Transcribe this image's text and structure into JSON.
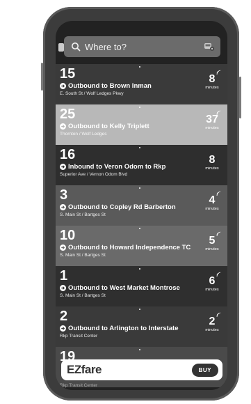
{
  "search": {
    "placeholder": "Where to?"
  },
  "routes": [
    {
      "number": "15",
      "destination": "Outbound to Brown Inman",
      "stop": "E. South St / Wolf Ledges Pkwy",
      "eta": "8",
      "eta_unit": "minutes",
      "realtime": true,
      "bg": "#3a3a3a"
    },
    {
      "number": "25",
      "destination": "Outbound to Kelly Triplett",
      "stop": "Thornton / Wolf Ledges",
      "eta": "37",
      "eta_unit": "minutes",
      "realtime": true,
      "bg": "#b8b8b8"
    },
    {
      "number": "16",
      "destination": "Inbound to Veron Odom to Rkp",
      "stop": "Superior Ave / Vernon Odom Blvd",
      "eta": "8",
      "eta_unit": "minutes",
      "realtime": false,
      "bg": "#2e2e2e"
    },
    {
      "number": "3",
      "destination": "Outbound to Copley Rd Barberton",
      "stop": "S. Main St / Bartges St",
      "eta": "4",
      "eta_unit": "minutes",
      "realtime": true,
      "bg": "#5a5a5a"
    },
    {
      "number": "10",
      "destination": "Outbound to Howard Independence TC",
      "stop": "S. Main St / Bartges St",
      "eta": "5",
      "eta_unit": "minutes",
      "realtime": true,
      "bg": "#6a6a6a"
    },
    {
      "number": "1",
      "destination": "Outbound to West Market Montrose",
      "stop": "S. Main St / Bartges St",
      "eta": "6",
      "eta_unit": "minutes",
      "realtime": true,
      "bg": "#2f2f2f"
    },
    {
      "number": "2",
      "destination": "Outbound to Arlington to Interstate",
      "stop": "Rkp Transit Center",
      "eta": "2",
      "eta_unit": "minutes",
      "realtime": true,
      "bg": "#3a3a3a"
    },
    {
      "number": "19",
      "destination": "",
      "stop": "",
      "eta": "",
      "eta_unit": "",
      "realtime": false,
      "bg": "#4a4a4a"
    }
  ],
  "buy_bar": {
    "logo": "EZfare",
    "button": "BUY"
  },
  "under_stop": "Rkp Transit Center",
  "colors": {
    "phone": "#3c3c3c",
    "screen": "#222222",
    "search_bg": "#6b6b6b",
    "buy_button": "#333333"
  }
}
